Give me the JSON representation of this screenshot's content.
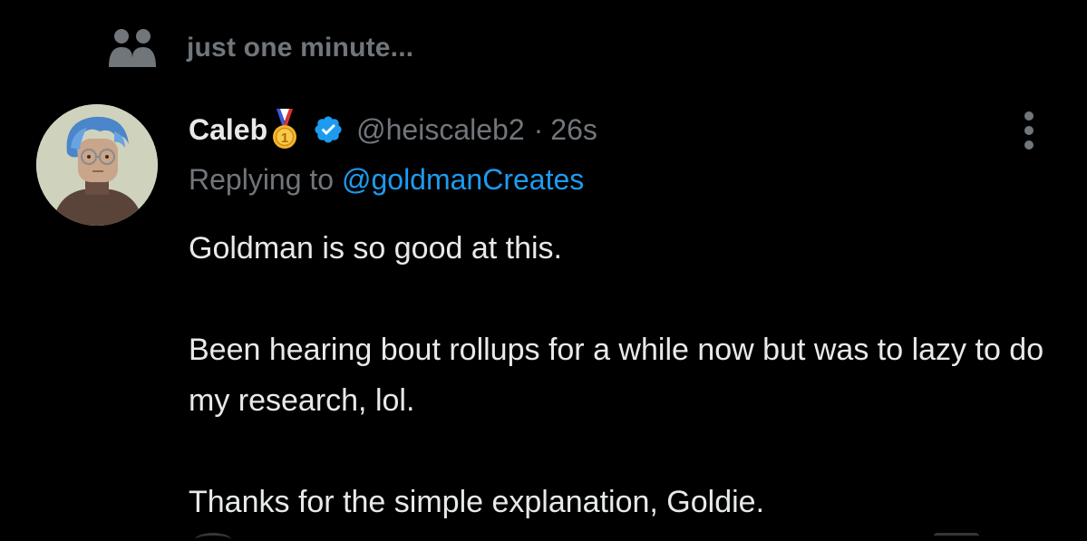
{
  "social_context": {
    "icon": "people-icon",
    "text": "just one minute..."
  },
  "tweet": {
    "author": {
      "display_name": "Caleb",
      "badge_icon": "first-place-medal-icon",
      "verified_icon": "verified-badge-icon",
      "handle": "@heiscaleb2",
      "separator": "·",
      "time": "26s",
      "avatar": "avatar-image"
    },
    "reply": {
      "prefix": "Replying to",
      "target": "@goldmanCreates"
    },
    "body": [
      "Goldman is so good at this.",
      "Been hearing bout rollups for a while now but was to lazy to do my research, lol.",
      "Thanks for the simple explanation, Goldie."
    ],
    "more_icon": "more-options-icon"
  },
  "colors": {
    "background": "#000000",
    "primary_text": "#e7e9ea",
    "secondary_text": "#71767b",
    "link": "#1d9bf0",
    "verified": "#1d9bf0",
    "medal_gold": "#f5b52e"
  }
}
